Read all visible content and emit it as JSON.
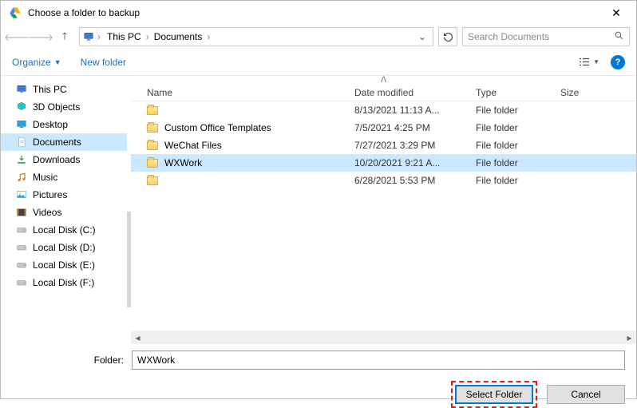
{
  "title": "Choose a folder to backup",
  "breadcrumb": {
    "root": "This PC",
    "folder": "Documents"
  },
  "search": {
    "placeholder": "Search Documents"
  },
  "toolbar": {
    "organize": "Organize",
    "newfolder": "New folder"
  },
  "sidebar": {
    "items": [
      {
        "label": "This PC",
        "kind": "pc"
      },
      {
        "label": "3D Objects",
        "kind": "3d"
      },
      {
        "label": "Desktop",
        "kind": "desktop"
      },
      {
        "label": "Documents",
        "kind": "documents",
        "selected": true
      },
      {
        "label": "Downloads",
        "kind": "downloads"
      },
      {
        "label": "Music",
        "kind": "music"
      },
      {
        "label": "Pictures",
        "kind": "pictures"
      },
      {
        "label": "Videos",
        "kind": "videos"
      },
      {
        "label": "Local Disk (C:)",
        "kind": "disk"
      },
      {
        "label": "Local Disk (D:)",
        "kind": "disk"
      },
      {
        "label": "Local Disk (E:)",
        "kind": "disk"
      },
      {
        "label": "Local Disk (F:)",
        "kind": "disk"
      }
    ]
  },
  "columns": {
    "name": "Name",
    "date": "Date modified",
    "type": "Type",
    "size": "Size"
  },
  "rows": [
    {
      "name": "",
      "date": "8/13/2021 11:13 A...",
      "type": "File folder"
    },
    {
      "name": "Custom Office Templates",
      "date": "7/5/2021 4:25 PM",
      "type": "File folder"
    },
    {
      "name": "WeChat Files",
      "date": "7/27/2021 3:29 PM",
      "type": "File folder"
    },
    {
      "name": "WXWork",
      "date": "10/20/2021 9:21 A...",
      "type": "File folder",
      "selected": true
    },
    {
      "name": "",
      "date": "6/28/2021 5:53 PM",
      "type": "File folder"
    }
  ],
  "footer": {
    "label": "Folder:",
    "value": "WXWork",
    "select": "Select Folder",
    "cancel": "Cancel"
  }
}
